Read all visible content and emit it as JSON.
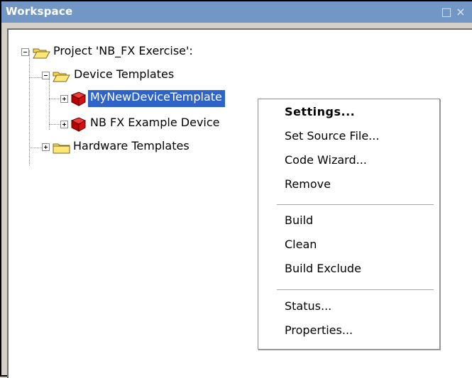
{
  "window": {
    "title": "Workspace",
    "restore_glyph": "□",
    "close_glyph": "×",
    "accent_color": "#7296c6"
  },
  "tree": {
    "project": "Project 'NB_FX Exercise':",
    "device_templates": "Device Templates",
    "items": [
      {
        "label": "MyNewDeviceTemplate",
        "selected": true
      },
      {
        "label": "NB FX Example Device",
        "selected": false
      }
    ],
    "hardware_templates": "Hardware Templates"
  },
  "context_menu": {
    "items": [
      {
        "label": "Settings...",
        "bold": true
      },
      {
        "label": "Set Source File..."
      },
      {
        "label": "Code Wizard..."
      },
      {
        "label": "Remove"
      },
      {
        "label": "Build"
      },
      {
        "label": "Clean"
      },
      {
        "label": "Build Exclude"
      },
      {
        "label": "Status..."
      },
      {
        "label": "Properties..."
      }
    ]
  },
  "icons": [
    "folder-icon",
    "open-folder-icon",
    "device-icon",
    "expand-icon",
    "collapse-icon"
  ]
}
